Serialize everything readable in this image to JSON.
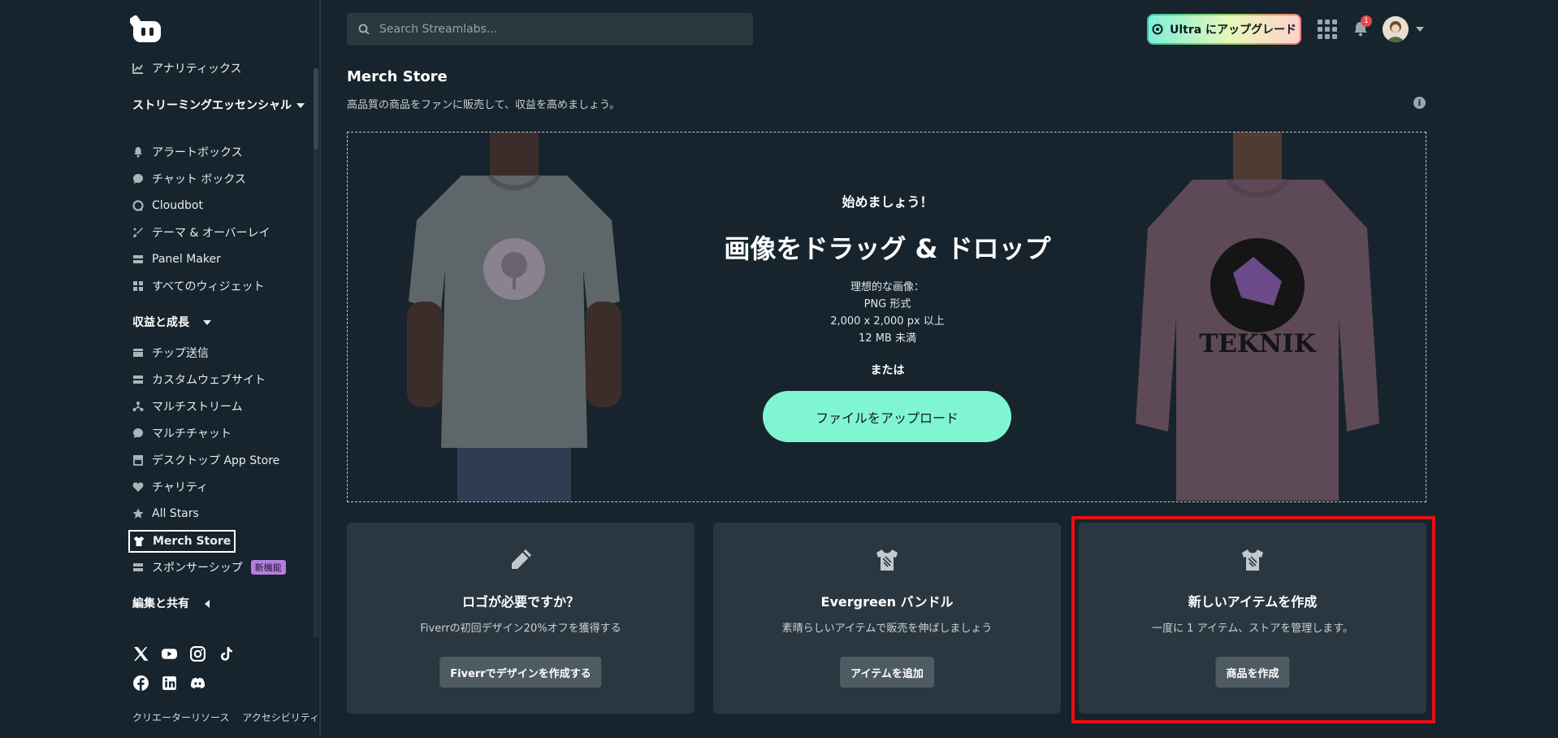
{
  "search": {
    "placeholder": "Search Streamlabs..."
  },
  "header": {
    "ultra_label": "Ultra にアップグレード",
    "notification_count": "1"
  },
  "sidebar": {
    "partial_item": "アナリティックス",
    "section_streaming": "ストリーミングエッセンシャル",
    "streaming_items": [
      {
        "label": "アラートボックス",
        "icon": "bell-icon"
      },
      {
        "label": "チャット ボックス",
        "icon": "chat-icon"
      },
      {
        "label": "Cloudbot",
        "icon": "cloudbot-icon"
      },
      {
        "label": "テーマ & オーバーレイ",
        "icon": "brush-icon"
      },
      {
        "label": "Panel Maker",
        "icon": "panel-icon"
      },
      {
        "label": "すべてのウィジェット",
        "icon": "grid-icon"
      }
    ],
    "section_revenue": "収益と成長",
    "revenue_items": [
      {
        "label": "チップ送信",
        "icon": "tip-icon"
      },
      {
        "label": "カスタムウェブサイト",
        "icon": "website-icon"
      },
      {
        "label": "マルチストリーム",
        "icon": "multistream-icon"
      },
      {
        "label": "マルチチャット",
        "icon": "multichat-icon"
      },
      {
        "label": "デスクトップ App Store",
        "icon": "store-icon"
      },
      {
        "label": "チャリティ",
        "icon": "heart-icon"
      },
      {
        "label": "All Stars",
        "icon": "star-icon"
      },
      {
        "label": "Merch Store",
        "icon": "shirt-icon"
      },
      {
        "label": "スポンサーシップ",
        "icon": "sponsor-icon",
        "badge": "新機能"
      }
    ],
    "section_edit": "編集と共有",
    "footer_links": [
      "クリエーターリソース",
      "アクセシビリティ"
    ]
  },
  "main": {
    "title": "Merch Store",
    "subtitle": "高品質の商品をファンに販売して、収益を高めましょう。",
    "dropzone": {
      "start": "始めましょう！",
      "heading": "画像をドラッグ & ドロップ",
      "requirements": [
        "理想的な画像：",
        "PNG 形式",
        "2,000 x 2,000 px 以上",
        "12 MB 未満"
      ],
      "or": "または",
      "upload_label": "ファイルをアップロード",
      "sweatshirt_text": "TEKNIK"
    },
    "cards": [
      {
        "title": "ロゴが必要ですか？",
        "desc": "Fiverrの初回デザイン20%オフを獲得する",
        "button": "Fiverrでデザインを作成する",
        "icon": "pencil-icon"
      },
      {
        "title": "Evergreen バンドル",
        "desc": "素晴らしいアイテムで販売を伸ばしましょう",
        "button": "アイテムを追加",
        "icon": "shirt-icon"
      },
      {
        "title": "新しいアイテムを作成",
        "desc": "一度に 1 アイテム、ストアを管理します。",
        "button": "商品を作成",
        "icon": "shirt-icon"
      }
    ]
  },
  "colors": {
    "background": "#17242d",
    "card": "#2b3740",
    "accent_mint": "#80f5d2",
    "highlight_red": "#e60f12",
    "badge_purple": "#b57fe0"
  }
}
